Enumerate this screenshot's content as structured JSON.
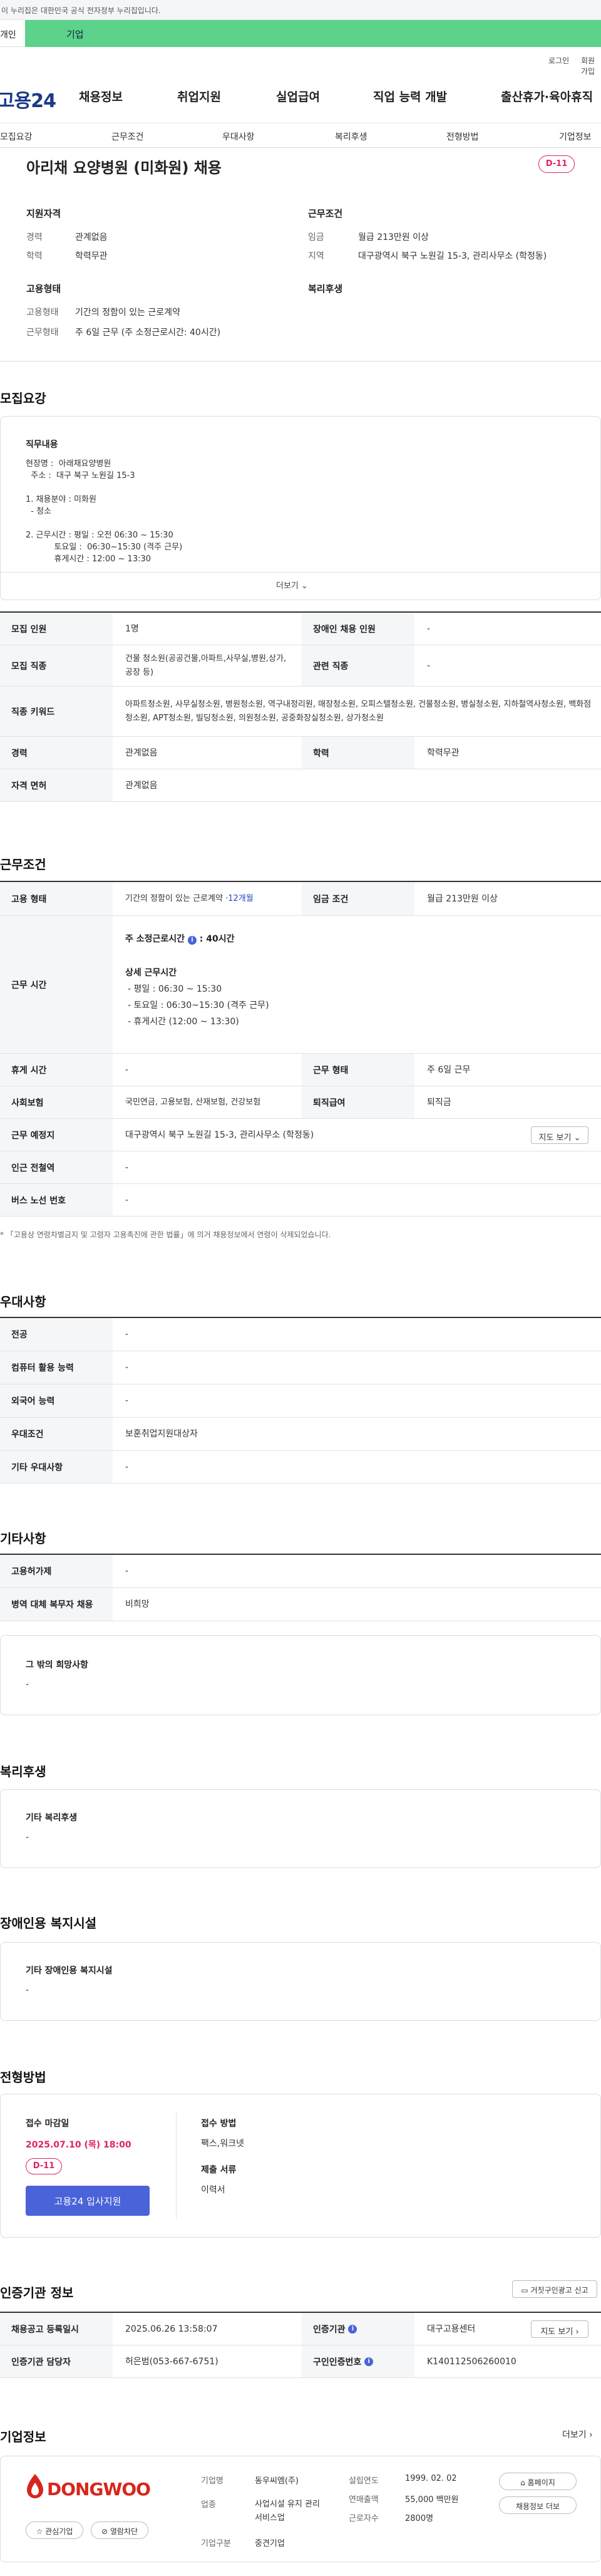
{
  "gov_banner": "이 누리집은 대한민국 공식 전자정부 누리집입니다.",
  "audience_tabs": [
    "개인",
    "기업"
  ],
  "util": {
    "login": "로그인",
    "join": "회원가입"
  },
  "logo": "고용24",
  "gnb": [
    "채용정보",
    "취업지원",
    "실업급여",
    "직업 능력 개발",
    "출산휴가·육아휴직"
  ],
  "subnav": [
    "모집요강",
    "근무조건",
    "우대사항",
    "복리후생",
    "전형방법",
    "기업정보"
  ],
  "job_title": "아리채 요양병원 (미화원) 채용",
  "dday": "D-11",
  "summary": {
    "qual_title": "지원자격",
    "cond_title": "근무조건",
    "emp_title": "고용형태",
    "welfare_title": "복리후생",
    "career_lbl": "경력",
    "career": "관계없음",
    "edu_lbl": "학력",
    "edu": "학력무관",
    "wage_lbl": "임금",
    "wage": "월급 213만원 이상",
    "region_lbl": "지역",
    "region": "대구광역시 북구 노원길 15-3, 관리사무소 (학정동)",
    "emptype_lbl": "고용형태",
    "emptype": "기간의 정함이 있는 근로계약",
    "worktype_lbl": "근무형태",
    "worktype": "주 6일 근무 (주 소정근로시간: 40시간)"
  },
  "recruit": {
    "section": "모집요강",
    "duty_title": "직무내용",
    "duty_text": "현장명 :  아래채요양병원\n  주소 :  대구 북구 노원길 15-3\n\n1. 채용분야 : 미화원\n  - 청소\n\n2. 근무시간 : 평일 : 오전 06:30 ~ 15:30\n           토요일 :  06:30~15:30 (격주 근무)\n           휴게시간 : 12:00 ~ 13:30",
    "more": "더보기",
    "h_count": "모집 인원",
    "count": "1명",
    "h_disabled": "장애인 채용 인원",
    "disabled": "-",
    "h_job": "모집 직종",
    "job": "건물 청소원(공공건물,아파트,사무실,병원,상가,공장 등)",
    "h_related": "관련 직종",
    "related": "-",
    "h_keyword": "직종 키워드",
    "keyword": "아파트청소원, 사무실청소원, 병원청소원, 역구내정리원, 매장청소원, 오피스텔청소원, 건물청소원, 병실청소원, 지하철역사청소원, 백화점청소원, APT청소원, 빌딩청소원, 의원청소원, 공중화장실청소원, 상가청소원",
    "h_career": "경력",
    "career": "관계없음",
    "h_edu": "학력",
    "edu": "학력무관",
    "h_license": "자격 면허",
    "license": "관계없음"
  },
  "conditions": {
    "section": "근무조건",
    "h_emp": "고용 형태",
    "emp": "기간의 정함이 있는 근로계약 · ",
    "emp_months": "12개월",
    "h_wage": "임금 조건",
    "wage": "월급 213만원 이상",
    "h_hours": "근무 시간",
    "hours_title": "주 소정근로시간",
    "hours_value": "40시간",
    "detail_title": "상세 근무시간",
    "detail_lines": [
      "- 평일 : 06:30 ~ 15:30",
      "- 토요일 :  06:30~15:30 (격주 근무)",
      "- 휴게시간 (12:00 ~ 13:30)"
    ],
    "h_break": "휴게 시간",
    "break": "-",
    "h_form": "근무 형태",
    "form": "주 6일 근무",
    "h_insurance": "사회보험",
    "insurance": "국민연금, 고용보험, 산재보험, 건강보험",
    "h_severance": "퇴직급여",
    "severance": "퇴직금",
    "h_place": "근무 예정지",
    "place": "대구광역시 북구 노원길 15-3, 관리사무소 (학정동)",
    "map_btn": "지도 보기",
    "h_subway": "인근 전철역",
    "subway": "-",
    "h_bus": "버스 노선 번호",
    "bus": "-",
    "note": "* 「고용상 연령차별금지 및 고령자 고용촉진에 관한 법률」에 의거 채용정보에서 연령이 삭제되었습니다."
  },
  "preference": {
    "section": "우대사항",
    "rows": [
      {
        "h": "전공",
        "v": "-"
      },
      {
        "h": "컴퓨터 활용 능력",
        "v": "-"
      },
      {
        "h": "외국어 능력",
        "v": "-"
      },
      {
        "h": "우대조건",
        "v": "보훈취업지원대상자"
      },
      {
        "h": "기타 우대사항",
        "v": "-"
      }
    ]
  },
  "etc": {
    "section": "기타사항",
    "rows": [
      {
        "h": "고용허가제",
        "v": "-"
      },
      {
        "h": "병역 대체 복무자 채용",
        "v": "비희망"
      }
    ],
    "other_title": "그 밖의 희망사항",
    "other": "-"
  },
  "welfare": {
    "section": "복리후생",
    "title": "기타 복리후생",
    "value": "-"
  },
  "facility": {
    "section": "장애인용 복지시설",
    "title": "기타 장애인용 복지시설",
    "value": "-"
  },
  "selection": {
    "section": "전형방법",
    "deadline_title": "접수 마감일",
    "deadline": "2025.07.10 (목) 18:00",
    "dday": "D-11",
    "apply_btn": "고용24 입사지원",
    "method_title": "접수 방법",
    "method": "팩스,워크넷",
    "docs_title": "제출 서류",
    "docs": "이력서"
  },
  "agency": {
    "section": "인증기관 정보",
    "report_btn": "거짓구인광고 신고",
    "h_reg": "채용공고 등록일시",
    "reg": "2025.06.26 13:58:07",
    "h_agency": "인증기관",
    "agency": "대구고용센터",
    "map_btn": "지도 보기",
    "h_manager": "인증기관 담당자",
    "manager": "허은범(053-667-6751)",
    "h_no": "구인인증번호",
    "no": "K140112506260010"
  },
  "company": {
    "section": "기업정보",
    "more": "더보기",
    "logo": "DONGWOO",
    "fav_btn": "관심기업",
    "block_btn": "열람차단",
    "h_name": "기업명",
    "name": "동우씨엠(주)",
    "h_biz": "업종",
    "biz": "사업시설 유지 관리 서비스업",
    "h_type": "기업구분",
    "type": "중견기업",
    "h_found": "설립연도",
    "found": "1999. 02. 02",
    "h_sales": "연매출액",
    "sales": "55,000 백만원",
    "h_emp": "근로자수",
    "emp": "2800명",
    "home_btn": "홈페이지",
    "jobs_btn": "채용정보 더보"
  },
  "colors": {
    "accent": "#e0245e",
    "primary": "#4a63d8",
    "green": "#5cd28a"
  }
}
